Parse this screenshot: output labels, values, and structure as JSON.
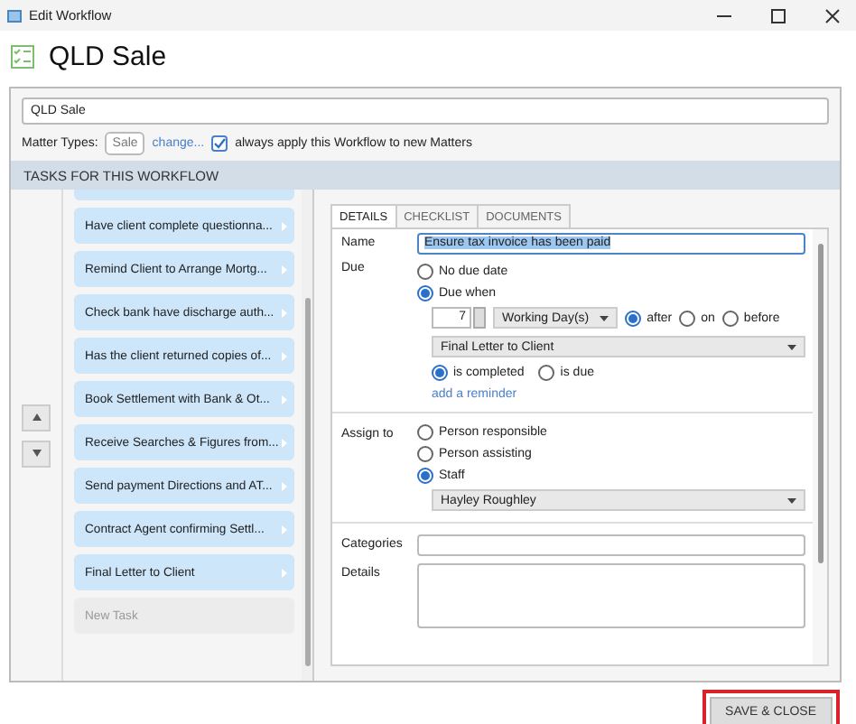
{
  "window": {
    "title": "Edit Workflow"
  },
  "header": {
    "title": "QLD Sale"
  },
  "workflow_name": {
    "value": "QLD Sale"
  },
  "matter_types": {
    "label": "Matter Types:",
    "tag": "Sale",
    "change_link": "change...",
    "always_apply": {
      "label": "always apply this Workflow to new Matters",
      "checked": true
    }
  },
  "tasks_section": {
    "title": "TASKS FOR THIS WORKFLOW"
  },
  "tasks": [
    {
      "label": "Have client complete questionna..."
    },
    {
      "label": "Remind Client to Arrange Mortg..."
    },
    {
      "label": "Check bank have discharge auth..."
    },
    {
      "label": "Has the client returned copies of..."
    },
    {
      "label": "Book Settlement with Bank & Ot..."
    },
    {
      "label": "Receive Searches & Figures from..."
    },
    {
      "label": "Send payment Directions and AT..."
    },
    {
      "label": "Contract Agent confirming Settl..."
    },
    {
      "label": "Final Letter to Client"
    }
  ],
  "new_task": {
    "placeholder": "New Task"
  },
  "details": {
    "tabs": [
      {
        "label": "DETAILS",
        "selected": true
      },
      {
        "label": "CHECKLIST",
        "selected": false
      },
      {
        "label": "DOCUMENTS",
        "selected": false
      }
    ],
    "name_label": "Name",
    "name_value": "Ensure tax invoice has been paid",
    "due_label": "Due",
    "due_options": [
      {
        "label": "No due date",
        "selected": false
      },
      {
        "label": "Due when",
        "selected": true
      }
    ],
    "offset_value": "7",
    "offset_unit": "Working Day(s)",
    "relation_options": [
      {
        "label": "after",
        "selected": true
      },
      {
        "label": "on",
        "selected": false
      },
      {
        "label": "before",
        "selected": false
      }
    ],
    "reference_task": "Final Letter to Client",
    "trigger_options": [
      {
        "label": "is completed",
        "selected": true
      },
      {
        "label": "is due",
        "selected": false
      }
    ],
    "reminder_link": "add a reminder",
    "assign_label": "Assign to",
    "assign_options": [
      {
        "label": "Person responsible",
        "selected": false
      },
      {
        "label": "Person assisting",
        "selected": false
      },
      {
        "label": "Staff",
        "selected": true
      }
    ],
    "staff": "Hayley Roughley",
    "categories_label": "Categories",
    "details_label": "Details"
  },
  "save_button": {
    "label": "SAVE & CLOSE"
  }
}
